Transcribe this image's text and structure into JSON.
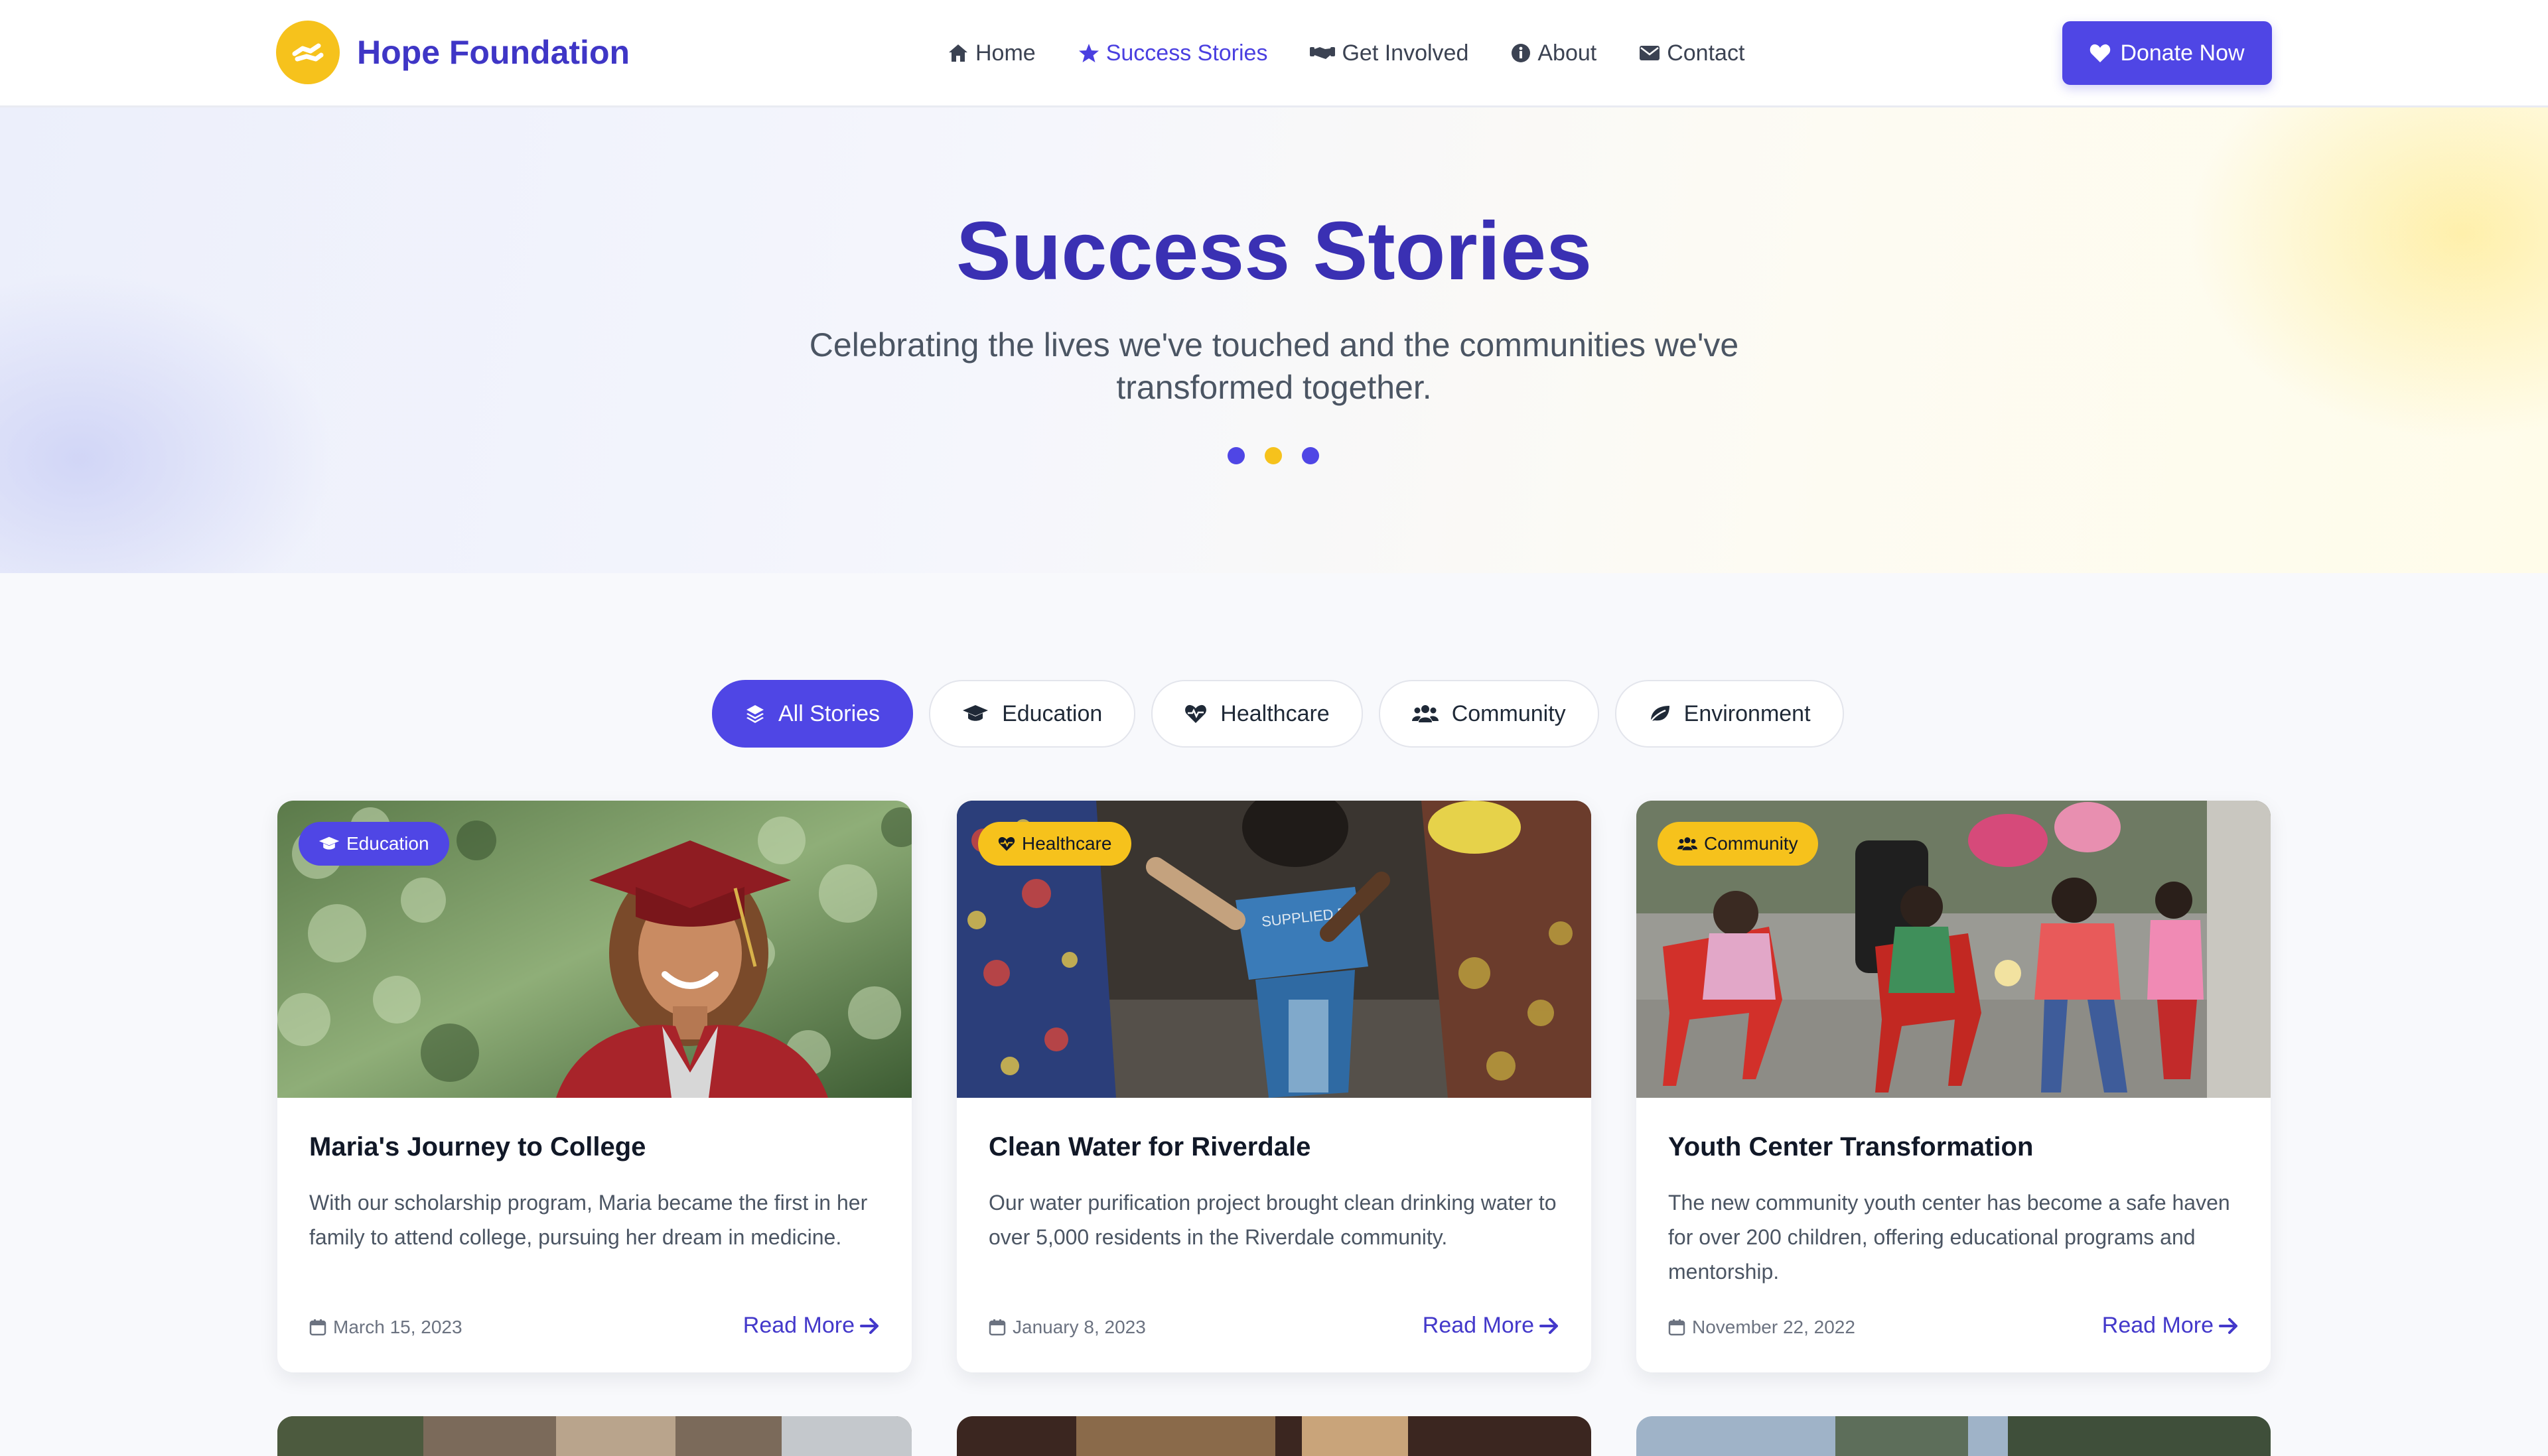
{
  "brand": {
    "name": "Hope Foundation",
    "logo_icon": "helping-hands-icon",
    "accent": "#4f46e5",
    "logo_color": "#f6c21c"
  },
  "nav": {
    "items": [
      {
        "label": "Home",
        "icon": "home-icon"
      },
      {
        "label": "Success Stories",
        "icon": "star-icon",
        "active": true
      },
      {
        "label": "Get Involved",
        "icon": "handshake-icon"
      },
      {
        "label": "About",
        "icon": "info-icon"
      },
      {
        "label": "Contact",
        "icon": "envelope-icon"
      }
    ],
    "donate_label": "Donate Now"
  },
  "hero": {
    "title": "Success Stories",
    "subtitle": "Celebrating the lives we've touched and the communities we've transformed together.",
    "dot_colors": [
      "#4f46e5",
      "#f6c21c",
      "#4f46e5"
    ]
  },
  "filters": [
    {
      "label": "All Stories",
      "icon": "layers-icon",
      "active": true
    },
    {
      "label": "Education",
      "icon": "graduation-cap-icon"
    },
    {
      "label": "Healthcare",
      "icon": "heart-pulse-icon"
    },
    {
      "label": "Community",
      "icon": "users-icon"
    },
    {
      "label": "Environment",
      "icon": "leaf-icon"
    }
  ],
  "stories": [
    {
      "category": "Education",
      "badge_color": "#4f46e5",
      "title": "Maria's Journey to College",
      "description": "With our scholarship program, Maria became the first in her family to attend college, pursuing her dream in medicine.",
      "date": "March 15, 2023",
      "read_more": "Read More"
    },
    {
      "category": "Healthcare",
      "badge_color": "#f6c21c",
      "title": "Clean Water for Riverdale",
      "description": "Our water purification project brought clean drinking water to over 5,000 residents in the Riverdale community.",
      "date": "January 8, 2023",
      "read_more": "Read More"
    },
    {
      "category": "Community",
      "badge_color": "#f6c21c",
      "title": "Youth Center Transformation",
      "description": "The new community youth center has become a safe haven for over 200 children, offering educational programs and mentorship.",
      "date": "November 22, 2022",
      "read_more": "Read More"
    }
  ]
}
